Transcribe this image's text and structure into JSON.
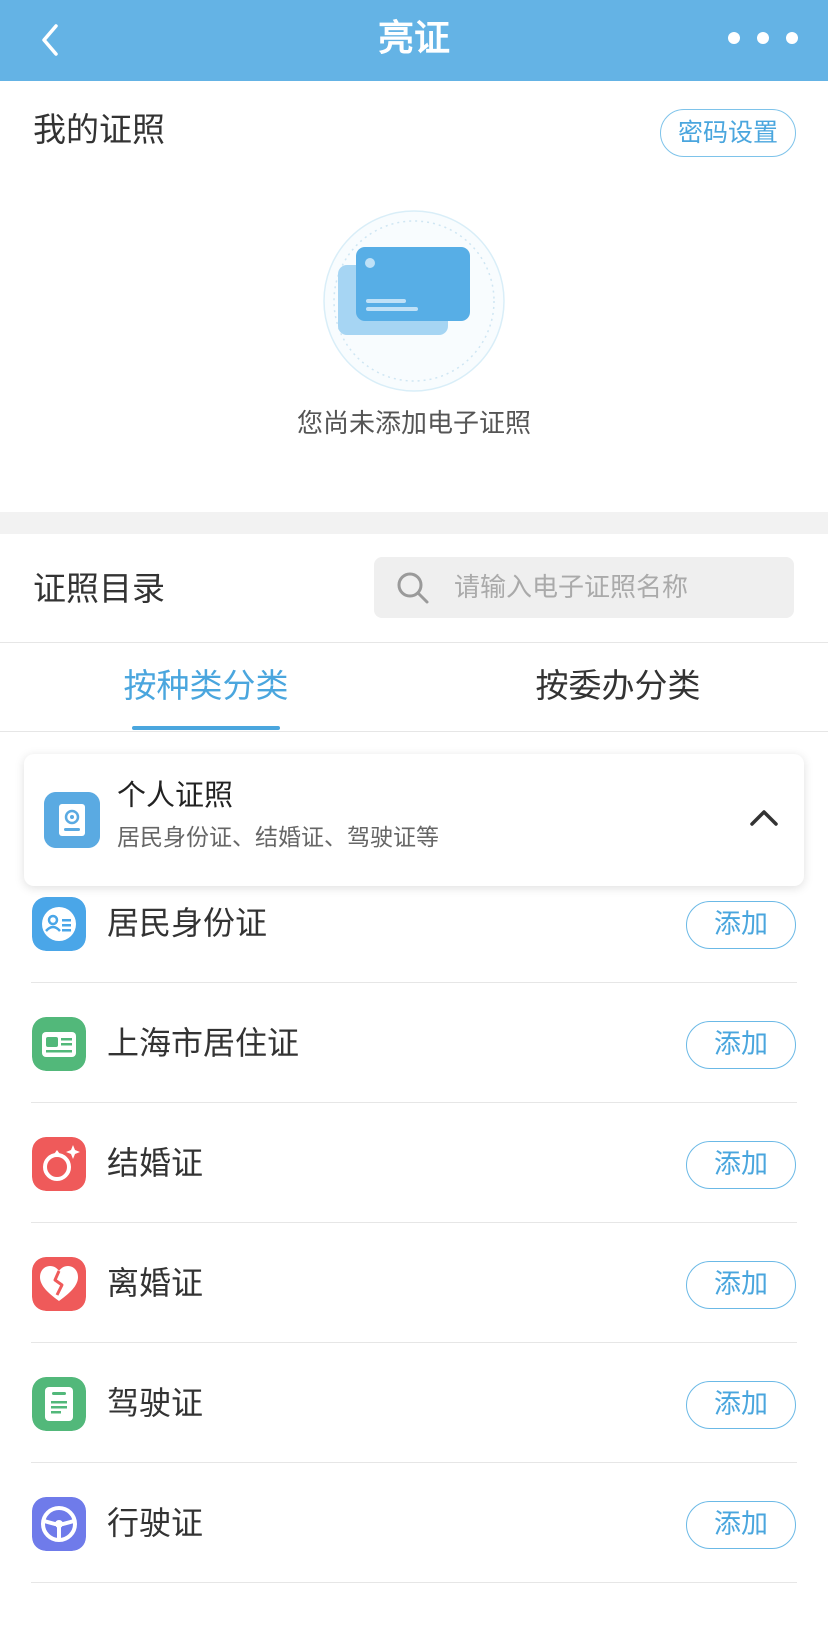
{
  "header": {
    "title": "亮证",
    "colors": {
      "bar": "#64b3e5"
    }
  },
  "my_licenses": {
    "title": "我的证照",
    "password_button": "密码设置",
    "empty_text": "您尚未添加电子证照"
  },
  "catalog": {
    "title": "证照目录",
    "search_placeholder": "请输入电子证照名称",
    "tabs": [
      {
        "label": "按种类分类",
        "active": true
      },
      {
        "label": "按委办分类",
        "active": false
      }
    ]
  },
  "category_card": {
    "title": "个人证照",
    "subtitle": "居民身份证、结婚证、驾驶证等",
    "icon": "id-badge-icon",
    "expanded": true
  },
  "items": [
    {
      "label": "居民身份证",
      "action": "添加",
      "icon": "id-card-icon",
      "color": "#4aa6e8"
    },
    {
      "label": "上海市居住证",
      "action": "添加",
      "icon": "residence-permit-icon",
      "color": "#52b87a"
    },
    {
      "label": "结婚证",
      "action": "添加",
      "icon": "marriage-certificate-icon",
      "color": "#ef5a5a"
    },
    {
      "label": "离婚证",
      "action": "添加",
      "icon": "broken-heart-icon",
      "color": "#ef5a5a"
    },
    {
      "label": "驾驶证",
      "action": "添加",
      "icon": "driver-license-icon",
      "color": "#52b87a"
    },
    {
      "label": "行驶证",
      "action": "添加",
      "icon": "steering-wheel-icon",
      "color": "#6f7bea"
    }
  ]
}
